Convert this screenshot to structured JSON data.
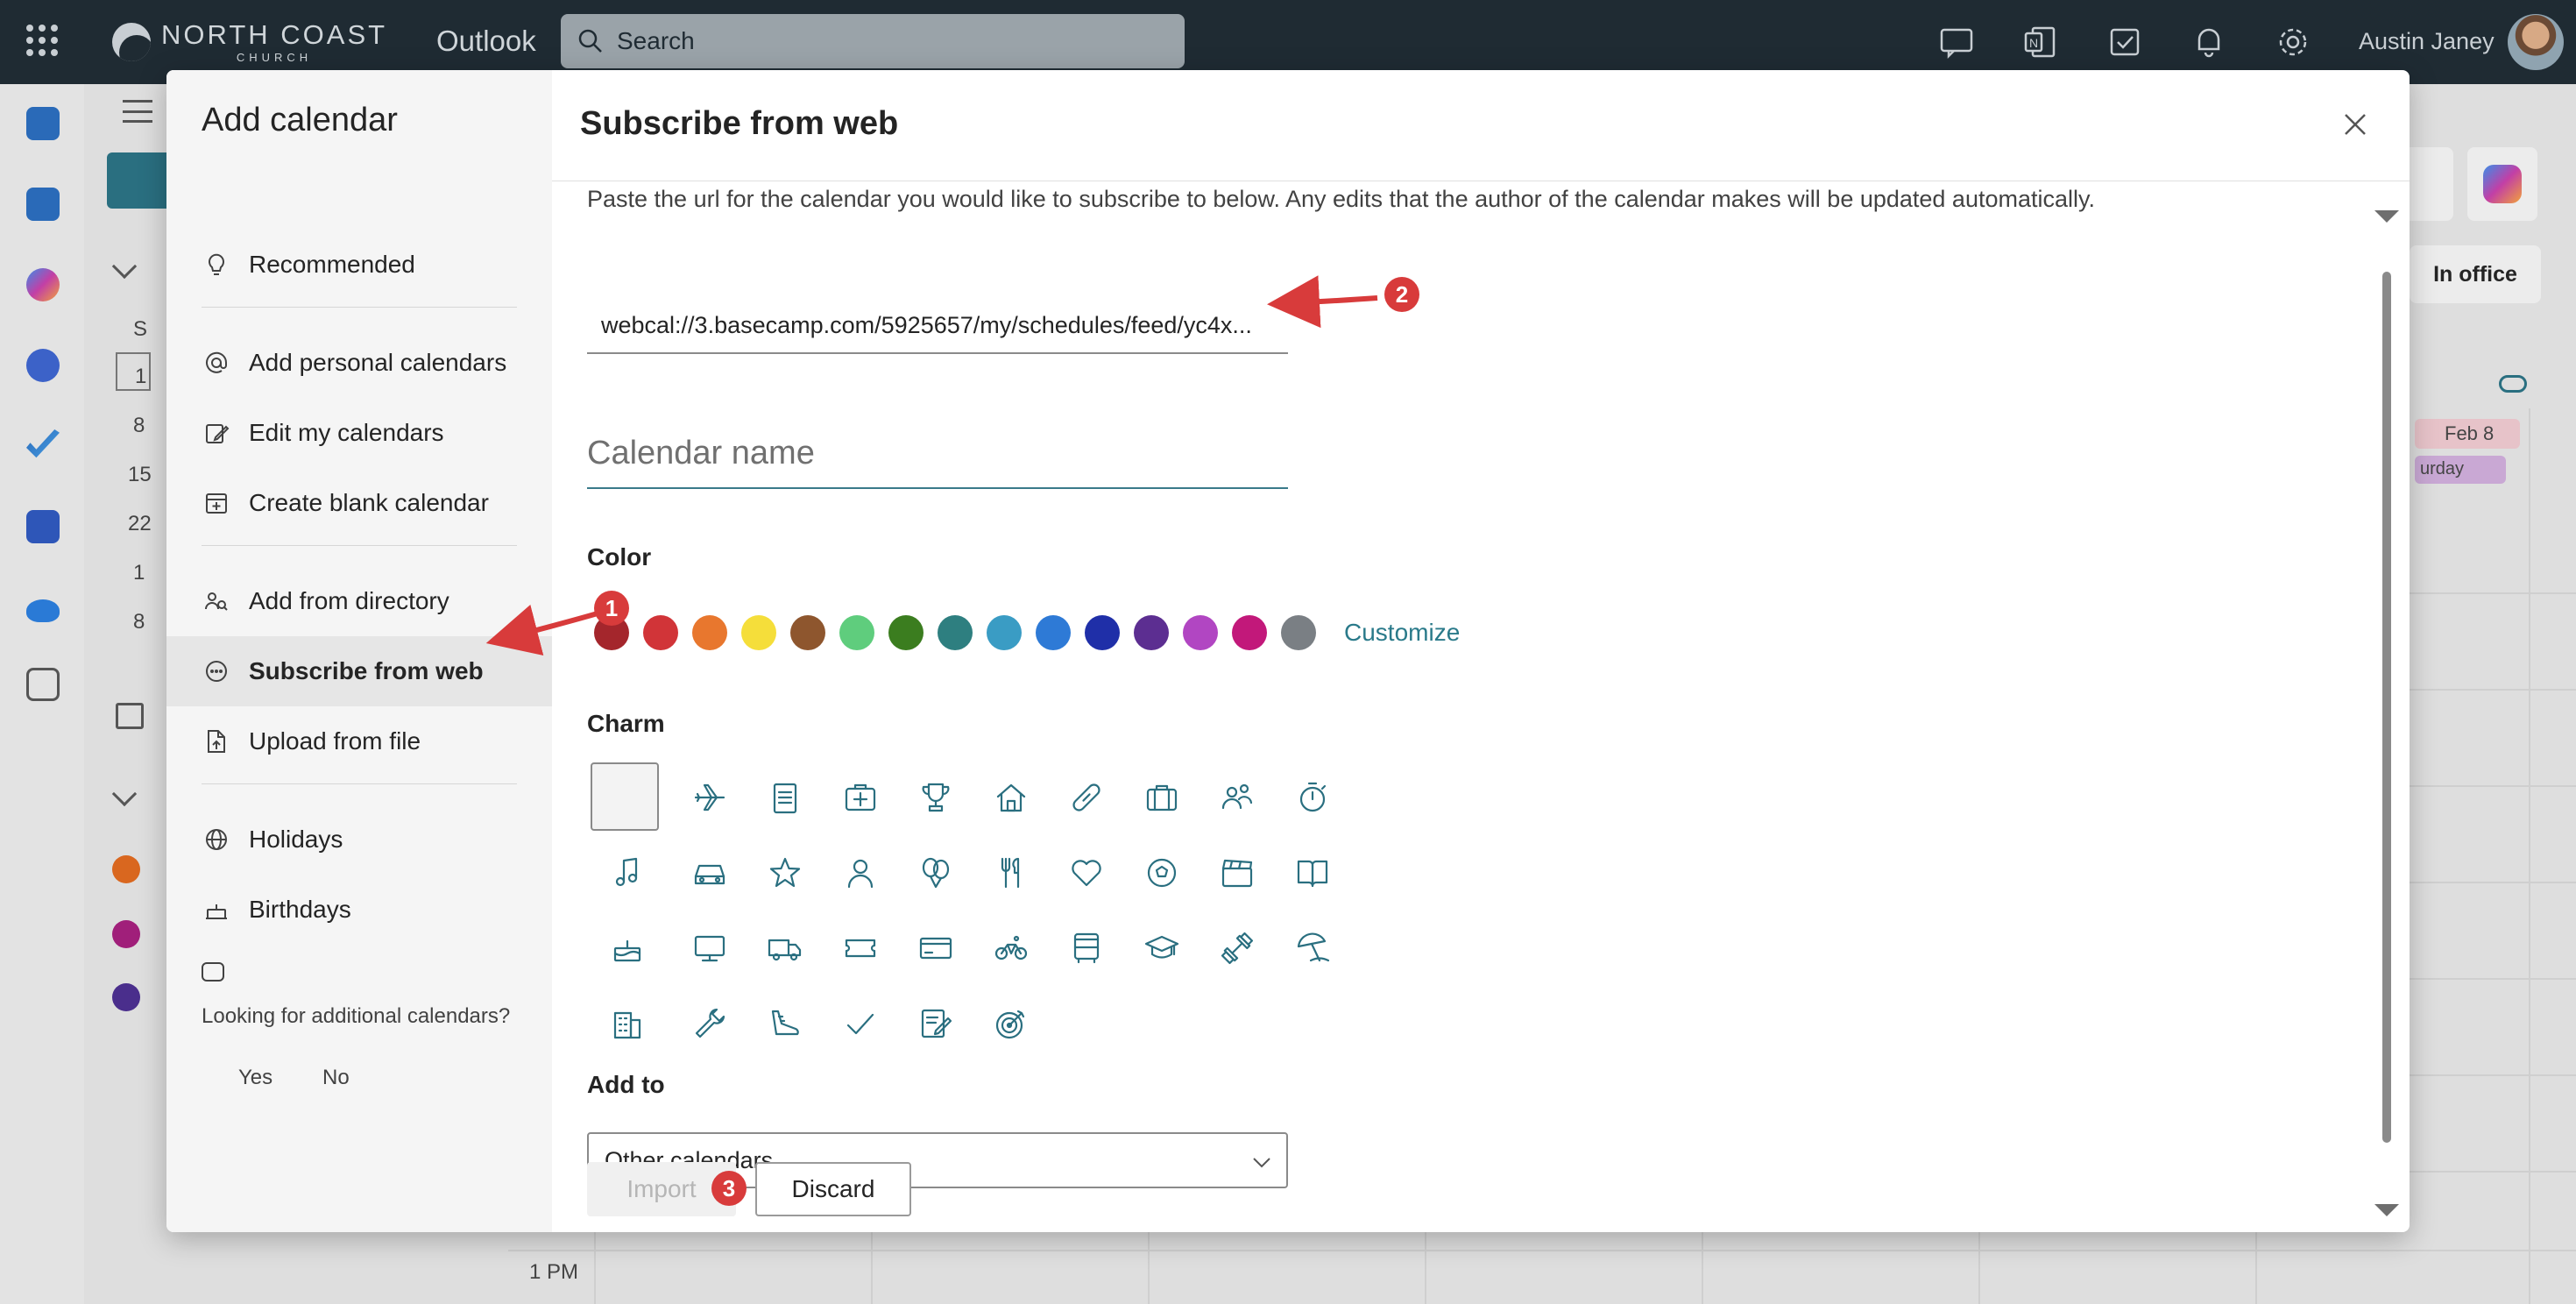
{
  "topbar": {
    "brand_name": "NORTH COAST",
    "brand_sub": "CHURCH",
    "app_name": "Outlook",
    "search_placeholder": "Search",
    "user_name": "Austin Janey"
  },
  "background": {
    "mini_cal_header": "S",
    "mini_cal_days": [
      "1",
      "8",
      "15",
      "22",
      "1",
      "8"
    ],
    "status_button": "In office",
    "date_nav": "Feb 8",
    "day_label": "urday",
    "time_label": "1 PM"
  },
  "sidebar": {
    "title": "Add calendar",
    "items": [
      {
        "label": "Recommended",
        "icon": "lightbulb-icon"
      },
      {
        "label": "Add personal calendars",
        "icon": "at-icon"
      },
      {
        "label": "Edit my calendars",
        "icon": "edit-icon"
      },
      {
        "label": "Create blank calendar",
        "icon": "calendar-add-icon"
      },
      {
        "label": "Add from directory",
        "icon": "people-search-icon"
      },
      {
        "label": "Subscribe from web",
        "icon": "more-circle-icon"
      },
      {
        "label": "Upload from file",
        "icon": "document-arrow-icon"
      },
      {
        "label": "Holidays",
        "icon": "globe-icon"
      },
      {
        "label": "Birthdays",
        "icon": "cake-icon"
      }
    ],
    "active_item": "Subscribe from web",
    "looking_text": "Looking for additional calendars?",
    "yes": "Yes",
    "no": "No"
  },
  "main": {
    "title": "Subscribe from web",
    "description": "Paste the url for the calendar you would like to subscribe to below. Any edits that the author of the calendar makes will be updated automatically.",
    "url_value": "webcal://3.basecamp.com/5925657/my/schedules/feed/yc4x...",
    "calendar_name_placeholder": "Calendar name",
    "color_label": "Color",
    "colors": [
      "#a4262c",
      "#d13438",
      "#e8772e",
      "#f5de3a",
      "#8e562e",
      "#5fcd7d",
      "#3b7d1f",
      "#2e7f80",
      "#3a9cc4",
      "#2e7ad6",
      "#1f2fa8",
      "#5c2e91",
      "#b146c2",
      "#c2187a",
      "#7a7f84"
    ],
    "customize": "Customize",
    "charm_label": "Charm",
    "charms": [
      "none",
      "airplane-icon",
      "clipboard-icon",
      "medical-bag-icon",
      "trophy-icon",
      "home-icon",
      "bandage-icon",
      "briefcase-icon",
      "people-icon",
      "timer-icon",
      "music-note-icon",
      "car-icon",
      "star-icon",
      "person-icon",
      "balloons-icon",
      "utensils-icon",
      "heart-icon",
      "soccer-ball-icon",
      "clapperboard-icon",
      "book-icon",
      "cake-icon",
      "monitor-icon",
      "truck-icon",
      "ticket-icon",
      "credit-card-icon",
      "bicycle-icon",
      "bus-icon",
      "graduation-cap-icon",
      "dumbbell-icon",
      "beach-umbrella-icon",
      "building-icon",
      "wrench-icon",
      "sneaker-icon",
      "checkmark-icon",
      "task-list-icon",
      "target-icon"
    ],
    "add_to_label": "Add to",
    "add_to_value": "Other calendars",
    "import_label": "Import",
    "discard_label": "Discard"
  },
  "annotations": {
    "badge1": "1",
    "badge2": "2",
    "badge3": "3",
    "color": "#d83b3b"
  }
}
